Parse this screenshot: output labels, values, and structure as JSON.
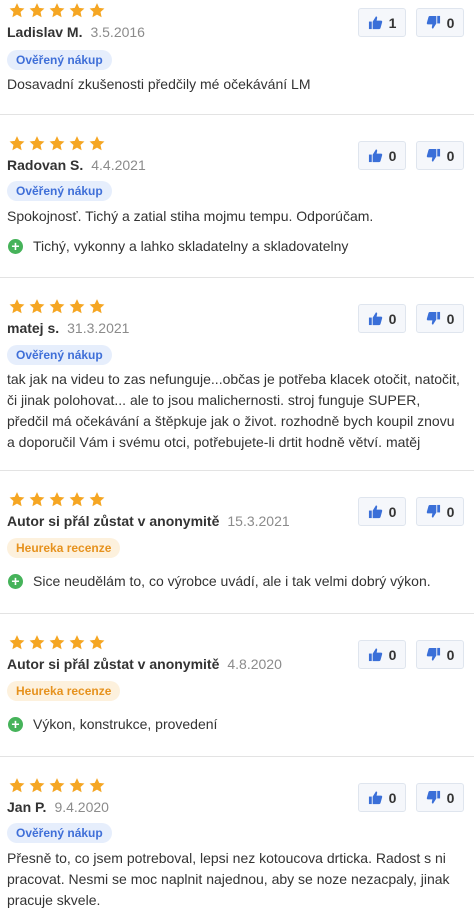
{
  "colors": {
    "star": "#f5a623",
    "vote_icon": "#3a6fd8",
    "pro_icon": "#46b35a",
    "verified_badge": "#3f6fd8",
    "heureka_badge": "#e6921e"
  },
  "reviews": [
    {
      "rating": 5,
      "author": "Ladislav M.",
      "date": "3.5.2016",
      "badge": "Ověřený nákup",
      "badge_type": "verified",
      "text": "Dosavadní zkušenosti předčily mé očekávání LM",
      "pros": [],
      "likes": "1",
      "dislikes": "0"
    },
    {
      "rating": 5,
      "author": "Radovan S.",
      "date": "4.4.2021",
      "badge": "Ověřený nákup",
      "badge_type": "verified",
      "text": "Spokojnosť. Tichý a zatial stiha mojmu tempu. Odporúčam.",
      "pros": [
        "Tichý, vykonny a lahko skladatelny a skladovatelny"
      ],
      "likes": "0",
      "dislikes": "0"
    },
    {
      "rating": 5,
      "author": "matej s.",
      "date": "31.3.2021",
      "badge": "Ověřený nákup",
      "badge_type": "verified",
      "text": "tak jak na videu to zas nefunguje...občas je potřeba klacek otočit, natočit, či jinak polohovat... ale to jsou malichernosti. stroj funguje SUPER, předčil má očekávání a štěpkuje jak o život. rozhodně bych koupil znovu a doporučil Vám i svému otci, potřebujete-li drtit hodně větví. matěj",
      "pros": [],
      "likes": "0",
      "dislikes": "0"
    },
    {
      "rating": 5,
      "author": "Autor si přál zůstat v anonymitě",
      "date": "15.3.2021",
      "badge": "Heureka recenze",
      "badge_type": "heureka",
      "text": "",
      "pros": [
        "Sice neudělám to, co výrobce uvádí, ale i tak velmi dobrý výkon."
      ],
      "likes": "0",
      "dislikes": "0"
    },
    {
      "rating": 5,
      "author": "Autor si přál zůstat v anonymitě",
      "date": "4.8.2020",
      "badge": "Heureka recenze",
      "badge_type": "heureka",
      "text": "",
      "pros": [
        "Výkon, konstrukce, provedení"
      ],
      "likes": "0",
      "dislikes": "0"
    },
    {
      "rating": 5,
      "author": "Jan P.",
      "date": "9.4.2020",
      "badge": "Ověřený nákup",
      "badge_type": "verified",
      "text": "Přesně to, co jsem potreboval, lepsi nez kotoucova drticka. Radost s ni pracovat. Nesmi se moc naplnit najednou, aby se noze nezacpaly, jinak pracuje skvele.",
      "pros": [],
      "likes": "0",
      "dislikes": "0"
    }
  ]
}
